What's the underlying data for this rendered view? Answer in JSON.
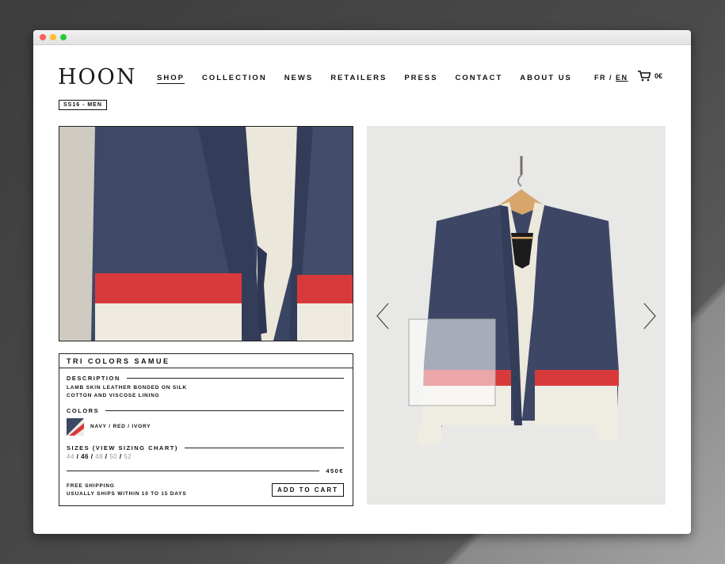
{
  "nav": {
    "logo": "HOON",
    "items": [
      {
        "label": "SHOP",
        "active": true
      },
      {
        "label": "COLLECTION"
      },
      {
        "label": "NEWS"
      },
      {
        "label": "RETAILERS"
      },
      {
        "label": "PRESS"
      },
      {
        "label": "CONTACT"
      },
      {
        "label": "ABOUT US"
      }
    ],
    "lang_fr": "FR",
    "lang_sep": "/",
    "lang_en": "EN",
    "cart_icon": "cart-icon",
    "cart_total": "0€"
  },
  "badge": "SS16 - MEN",
  "product": {
    "title": "TRI COLORS SAMUE",
    "description_heading": "DESCRIPTION",
    "description_line1": "LAMB SKIN LEATHER BONDED ON SILK",
    "description_line2": "COTTON AND VISCOSE LINING",
    "colors_heading": "COLORS",
    "colors_value": "NAVY / RED / IVORY",
    "sizes_heading": "SIZES (VIEW SIZING CHART)",
    "sizes": [
      {
        "label": "44",
        "available": false
      },
      {
        "label": "46",
        "available": true
      },
      {
        "label": "48",
        "available": false
      },
      {
        "label": "50",
        "available": false
      },
      {
        "label": "52",
        "available": false
      }
    ],
    "price": "450€",
    "shipping_line1": "FREE SHIPPING",
    "shipping_line2": "USUALLY SHIPS WITHIN 10 TO 15 DAYS",
    "add_to_cart": "ADD TO CART"
  },
  "colors": {
    "navy": "#3c4766",
    "red": "#d83a3c",
    "ivory": "#efece2"
  }
}
